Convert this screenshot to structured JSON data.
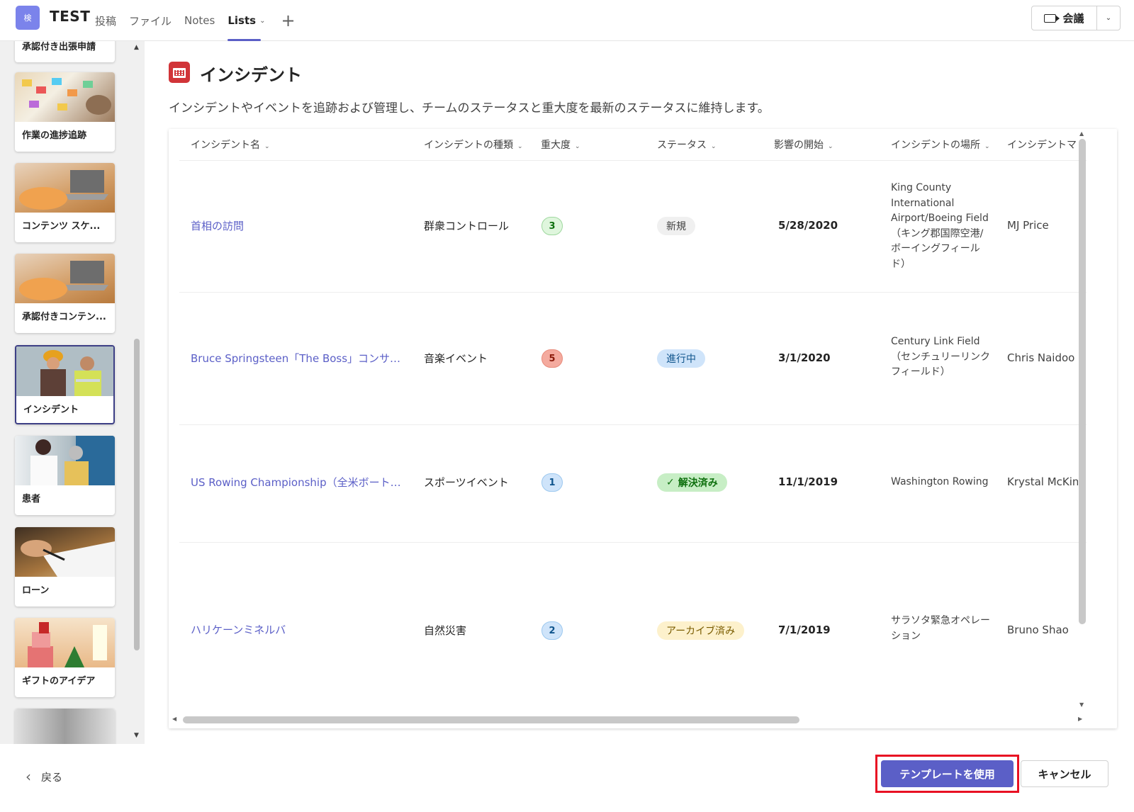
{
  "header": {
    "team_avatar": "検",
    "team_name": "TEST",
    "tabs": [
      {
        "label": "投稿"
      },
      {
        "label": "ファイル"
      },
      {
        "label": "Notes"
      },
      {
        "label": "Lists"
      }
    ],
    "meet_label": "会議"
  },
  "sidebar": {
    "templates": [
      {
        "label": "承認付き出張申請"
      },
      {
        "label": "作業の進捗追跡"
      },
      {
        "label": "コンテンツ スケ..."
      },
      {
        "label": "承認付きコンテン..."
      },
      {
        "label": "インシデント"
      },
      {
        "label": "患者"
      },
      {
        "label": "ローン"
      },
      {
        "label": "ギフトのアイデア"
      }
    ]
  },
  "list": {
    "title": "インシデント",
    "description": "インシデントやイベントを追跡および管理し、チームのステータスと重大度を最新のステータスに維持します。",
    "columns": [
      {
        "label": "インシデント名"
      },
      {
        "label": "インシデントの種類"
      },
      {
        "label": "重大度"
      },
      {
        "label": "ステータス"
      },
      {
        "label": "影響の開始"
      },
      {
        "label": "インシデントの場所"
      },
      {
        "label": "インシデントマ"
      }
    ],
    "rows": [
      {
        "name": "首相の訪問",
        "type": "群衆コントロール",
        "severity": "3",
        "status": "新規",
        "start": "5/28/2020",
        "location": "King County International Airport/Boeing Field（キング郡国際空港/ボーイングフィールド）",
        "manager": "MJ Price"
      },
      {
        "name": "Bruce Springsteen「The Boss」コンサート",
        "type": "音楽イベント",
        "severity": "5",
        "status": "進行中",
        "start": "3/1/2020",
        "location": "Century Link Field（センチュリーリンクフィールド）",
        "manager": "Chris Naidoo"
      },
      {
        "name": "US Rowing Championship（全米ボート選...",
        "type": "スポーツイベント",
        "severity": "1",
        "status": "解決済み",
        "start": "11/1/2019",
        "location": "Washington Rowing",
        "manager": "Krystal McKinr"
      },
      {
        "name": "ハリケーンミネルバ",
        "type": "自然災害",
        "severity": "2",
        "status": "アーカイブ済み",
        "start": "7/1/2019",
        "location": "サラソタ緊急オペレーション",
        "manager": "Bruno Shao"
      }
    ]
  },
  "footer": {
    "back_label": "戻る",
    "use_template_label": "テンプレートを使用",
    "cancel_label": "キャンセル"
  },
  "colors": {
    "accent": "#5b5fc7",
    "highlight": "#e81123",
    "severity_3": "#dff6dd",
    "severity_5": "#f4aa9e",
    "severity_1": "#cfe4fa",
    "severity_2": "#cfe4fa",
    "status_new": "#f0f0f0",
    "status_in_progress": "#cfe4fa",
    "status_resolved": "#c7eec5",
    "status_archived": "#fdf1cc"
  },
  "icons": {
    "list_icon": "calendar-list-icon",
    "camera": "video-camera-icon",
    "add_tab": "plus-icon",
    "back": "chevron-left-icon"
  }
}
